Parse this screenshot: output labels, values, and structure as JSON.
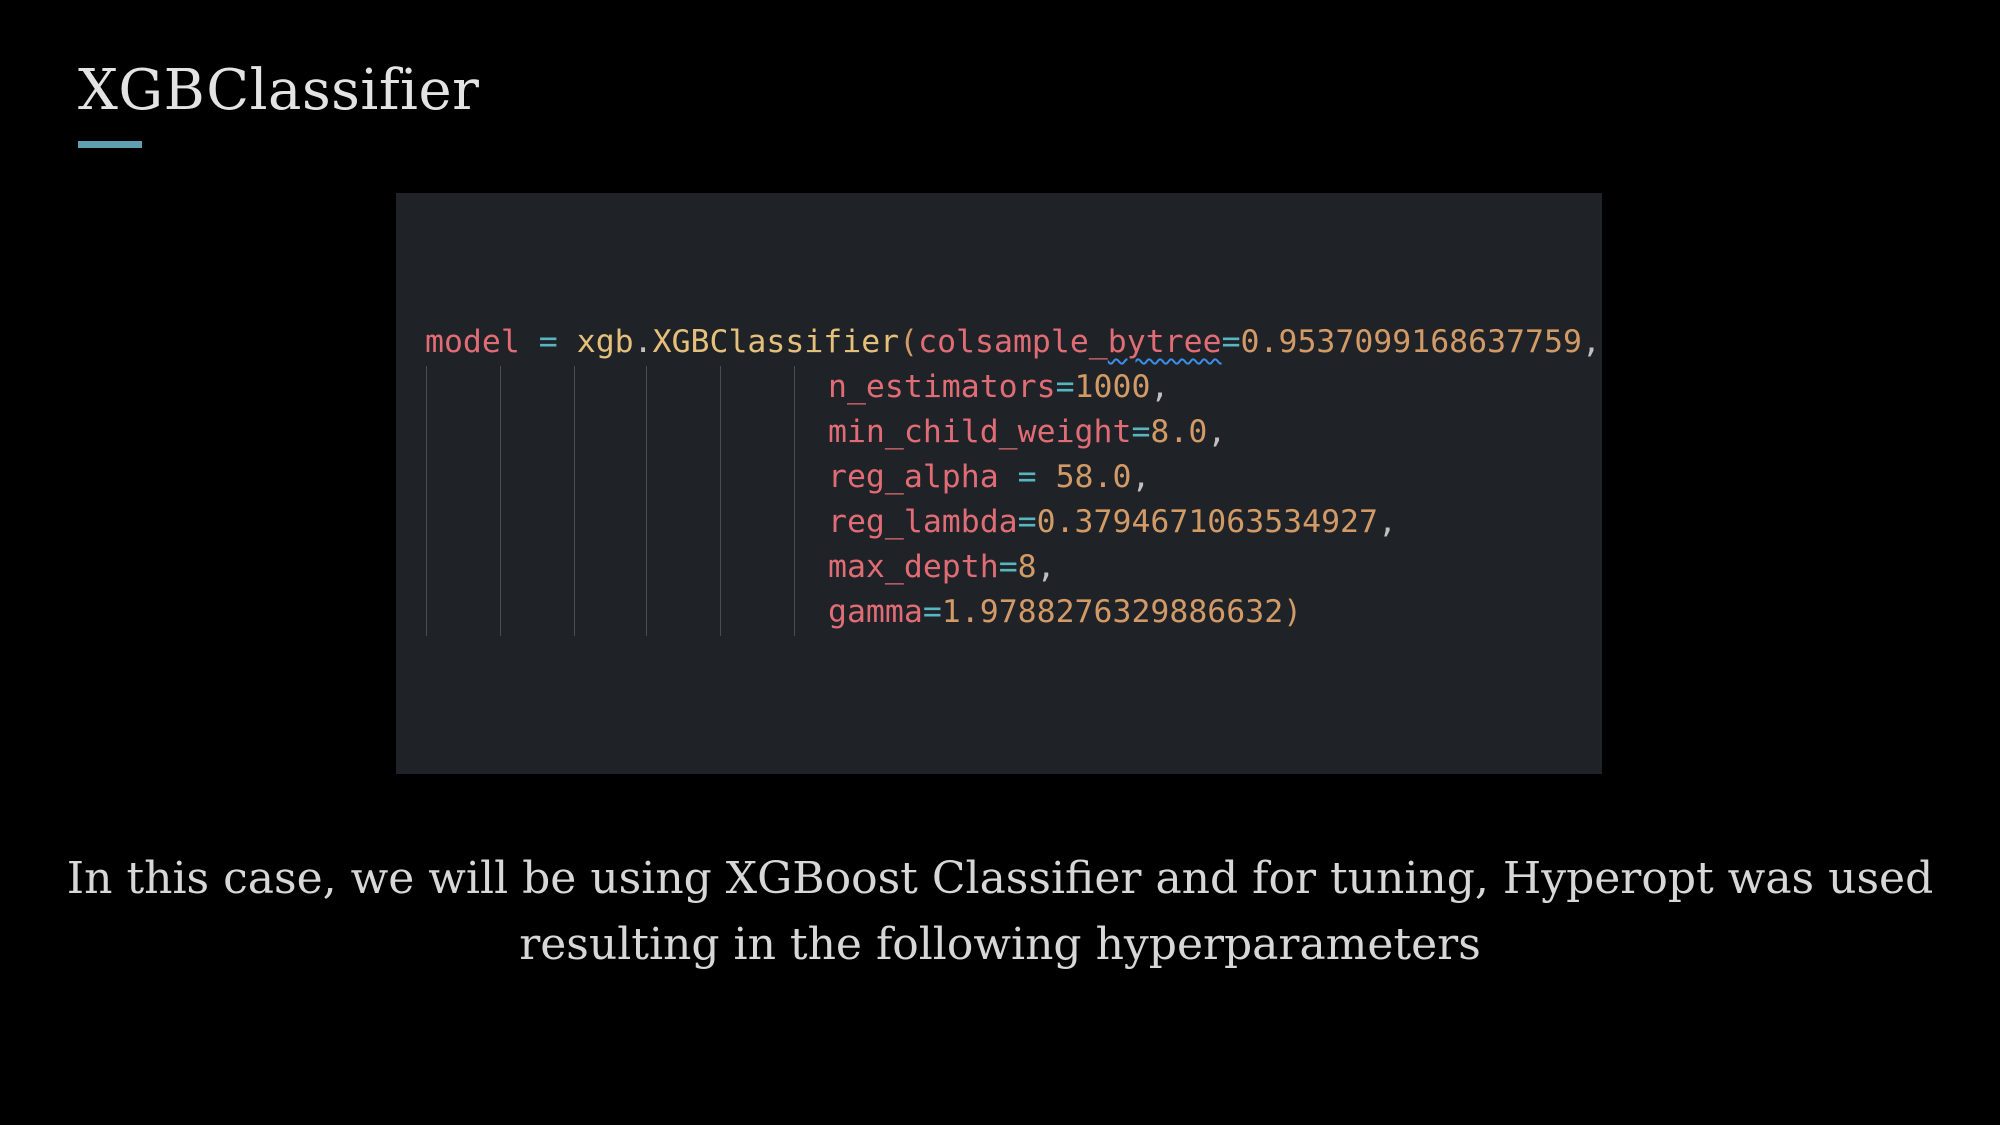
{
  "slide": {
    "title": "XGBClassifier",
    "caption": "In this case, we will be using XGBoost Classifier and for tuning, Hyperopt was used resulting in the following hyperparameters"
  },
  "code": {
    "line1": {
      "var": "model",
      "assign": "=",
      "module": "xgb",
      "dot": ".",
      "cls": "XGBClassifier",
      "open_paren": "(",
      "kw_a": "colsample_",
      "kw_b": "bytree",
      "eq": "=",
      "value": "0.9537099168637759",
      "comma": ","
    },
    "params": [
      {
        "kw": "n_estimators",
        "eq": "=",
        "value": "1000",
        "end": ","
      },
      {
        "kw": "min_child_weight",
        "eq": "=",
        "value": "8.0",
        "end": ","
      },
      {
        "kw": "reg_alpha",
        "eq": " = ",
        "value": "58.0",
        "end": ","
      },
      {
        "kw": "reg_lambda",
        "eq": "=",
        "value": "0.3794671063534927",
        "end": ","
      },
      {
        "kw": "max_depth",
        "eq": "=",
        "value": "8",
        "end": ","
      },
      {
        "kw": "gamma",
        "eq": "=",
        "value": "1.9788276329886632",
        "end": ")"
      }
    ]
  },
  "colors": {
    "background": "#000000",
    "code_background": "#1f2226",
    "accent": "#5f9fb0",
    "variable": "#e06c75",
    "operator": "#56b6c2",
    "module": "#e5c07b",
    "number": "#d19a66"
  }
}
